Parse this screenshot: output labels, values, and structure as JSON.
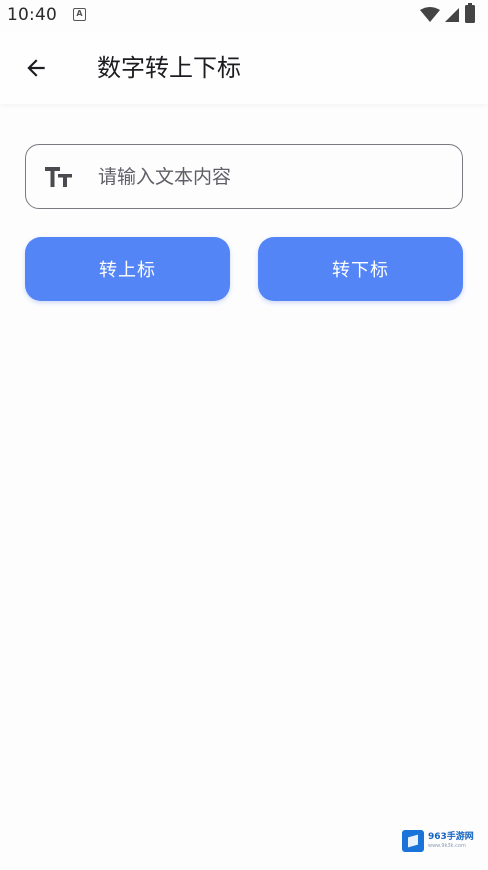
{
  "status_bar": {
    "time": "10:40",
    "notification_badge": "A",
    "icons": [
      "wifi-icon",
      "signal-icon",
      "battery-icon"
    ]
  },
  "app_bar": {
    "back_icon": "arrow-left-icon",
    "title": "数字转上下标"
  },
  "input": {
    "icon": "text-fields-icon",
    "value": "",
    "placeholder": "请输入文本内容"
  },
  "buttons": {
    "superscript_label": "转上标",
    "subscript_label": "转下标"
  },
  "watermark": {
    "brand": "963手游网",
    "site": "www.9k3k.com"
  },
  "colors": {
    "accent": "#5485f6",
    "background": "#fdfdfe",
    "outline": "#7a7a80",
    "watermark_blue": "#1a73d9"
  }
}
